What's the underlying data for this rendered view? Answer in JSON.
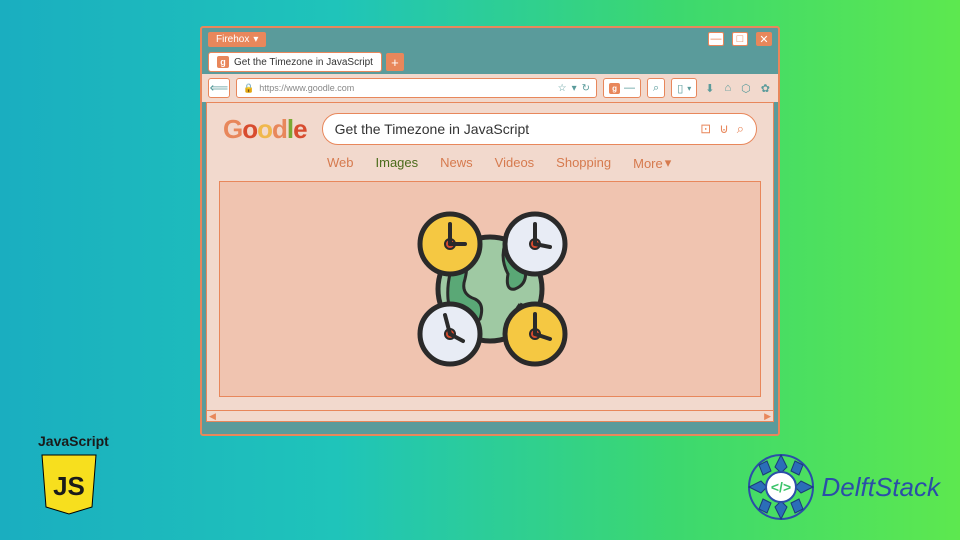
{
  "titlebar": {
    "menu": "Firehox"
  },
  "tab": {
    "title": "Get the Timezone in JavaScript",
    "icon": "g"
  },
  "url": "https://www.goodle.com",
  "logo_chars": {
    "g": "G",
    "o1": "o",
    "o2": "o",
    "d": "d",
    "l": "l",
    "e": "e"
  },
  "search": {
    "query": "Get the Timezone in JavaScript"
  },
  "nav": {
    "web": "Web",
    "images": "Images",
    "news": "News",
    "videos": "Videos",
    "shopping": "Shopping",
    "more": "More"
  },
  "js_badge": {
    "label": "JavaScript",
    "icon_text": "JS"
  },
  "delft": {
    "text": "DelftStack"
  }
}
